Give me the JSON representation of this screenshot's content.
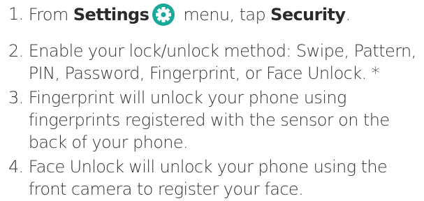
{
  "steps": [
    {
      "number": "1. ",
      "pre": "From ",
      "settings": "Settings",
      "mid": " menu, tap ",
      "security": "Security",
      "end": "."
    },
    {
      "number": "2. ",
      "lines": [
        "Enable your lock/unlock method: Swipe, Pattern,",
        "PIN, Password, Fingerprint, or Face Unlock. *"
      ]
    },
    {
      "number": "3. ",
      "lines": [
        "Fingerprint will unlock your phone using",
        "fingerprints registered with the sensor on the",
        "back of your phone."
      ]
    },
    {
      "number": "4. ",
      "lines": [
        "Face Unlock will unlock your phone using the",
        "front camera to register your face."
      ]
    }
  ],
  "colors": {
    "text": "#333333",
    "settings_icon_bg": "#1aa89a",
    "settings_icon_fg": "#ffffff"
  },
  "icons": {
    "settings": "gear-icon"
  }
}
